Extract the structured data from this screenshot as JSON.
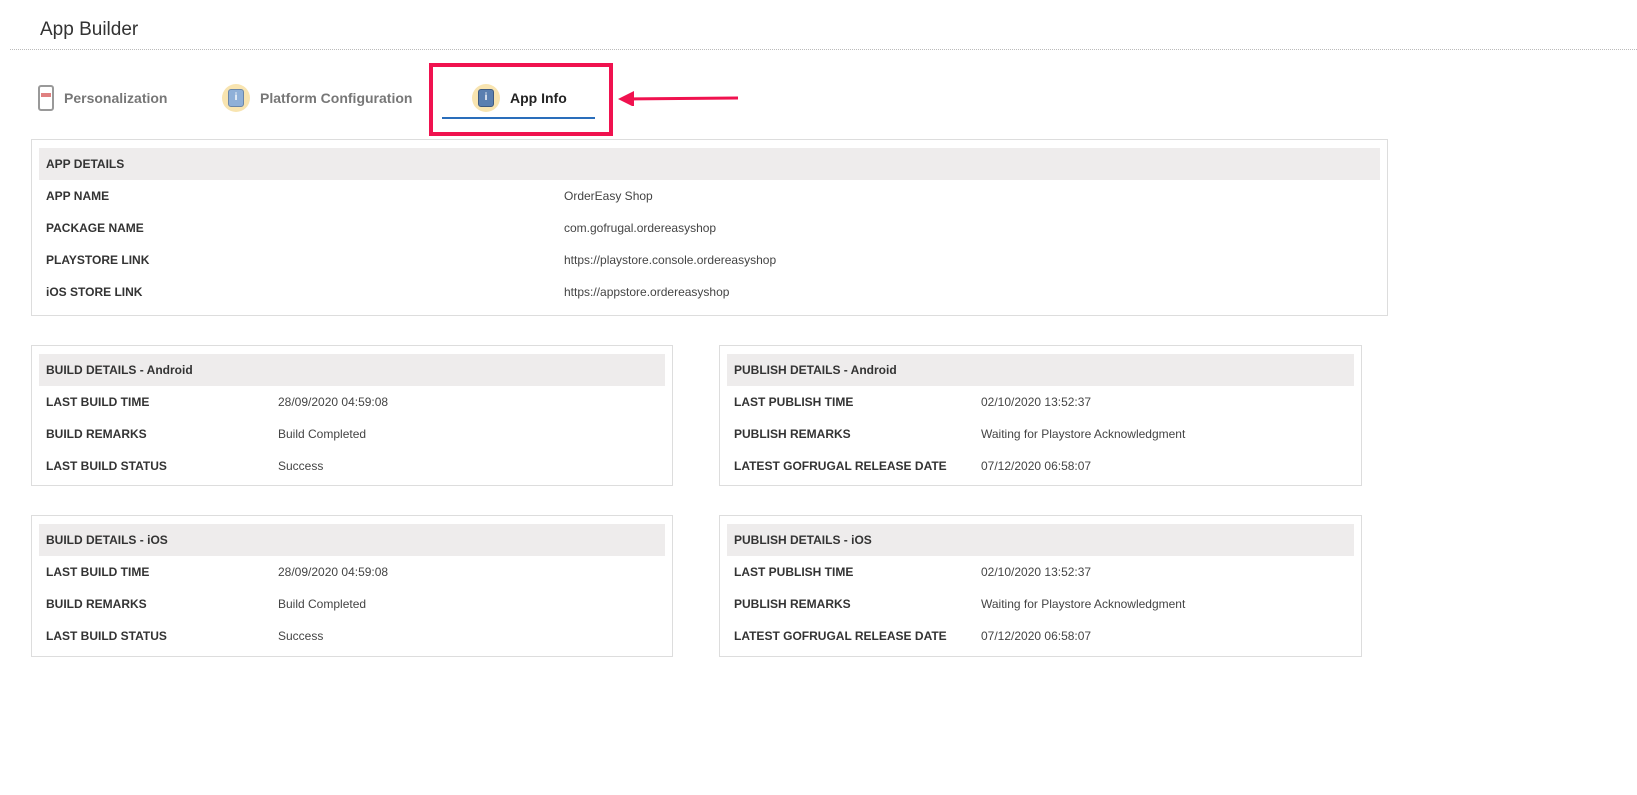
{
  "header": {
    "title": "App Builder"
  },
  "tabs": [
    {
      "label": "Personalization",
      "icon": "phone-store-icon"
    },
    {
      "label": "Platform Configuration",
      "icon": "info-icon"
    },
    {
      "label": "App Info",
      "icon": "info-icon",
      "active": true
    }
  ],
  "app_details": {
    "title": "APP DETAILS",
    "rows": [
      {
        "label": "APP NAME",
        "value": "OrderEasy Shop"
      },
      {
        "label": "PACKAGE NAME",
        "value": "com.gofrugal.ordereasyshop"
      },
      {
        "label": "PLAYSTORE LINK",
        "value": "https://playstore.console.ordereasyshop"
      },
      {
        "label": "iOS STORE LINK",
        "value": "https://appstore.ordereasyshop"
      }
    ]
  },
  "build_android": {
    "title": "BUILD DETAILS - Android",
    "rows": [
      {
        "label": "LAST BUILD TIME",
        "value": "28/09/2020 04:59:08"
      },
      {
        "label": "BUILD REMARKS",
        "value": "Build Completed"
      },
      {
        "label": "LAST BUILD STATUS",
        "value": "Success"
      }
    ]
  },
  "publish_android": {
    "title": "PUBLISH DETAILS - Android",
    "rows": [
      {
        "label": "LAST PUBLISH TIME",
        "value": "02/10/2020 13:52:37"
      },
      {
        "label": "PUBLISH REMARKS",
        "value": "Waiting for Playstore Acknowledgment"
      },
      {
        "label": "LATEST GOFRUGAL RELEASE DATE",
        "value": "07/12/2020 06:58:07"
      }
    ]
  },
  "build_ios": {
    "title": "BUILD DETAILS - iOS",
    "rows": [
      {
        "label": "LAST BUILD TIME",
        "value": "28/09/2020 04:59:08"
      },
      {
        "label": "BUILD REMARKS",
        "value": "Build Completed"
      },
      {
        "label": "LAST BUILD STATUS",
        "value": "Success"
      }
    ]
  },
  "publish_ios": {
    "title": "PUBLISH DETAILS - iOS",
    "rows": [
      {
        "label": "LAST PUBLISH TIME",
        "value": "02/10/2020 13:52:37"
      },
      {
        "label": "PUBLISH REMARKS",
        "value": "Waiting for Playstore Acknowledgment"
      },
      {
        "label": "LATEST GOFRUGAL RELEASE DATE",
        "value": "07/12/2020 06:58:07"
      }
    ]
  },
  "colors": {
    "highlight": "#f0124f",
    "tab_underline": "#2a6ebb",
    "section_header_bg": "#eeecec"
  }
}
